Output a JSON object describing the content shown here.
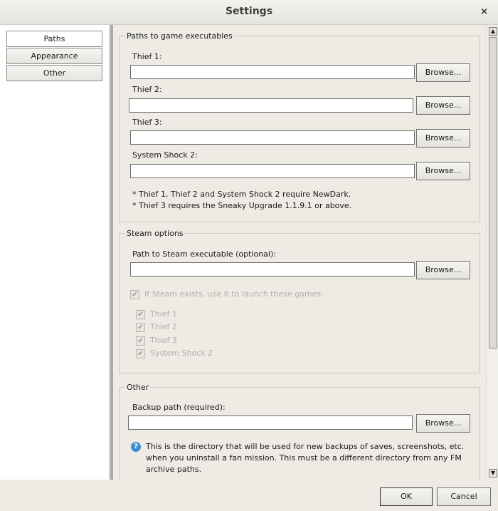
{
  "window": {
    "title": "Settings",
    "close_glyph": "×"
  },
  "nav": {
    "items": [
      "Paths",
      "Appearance",
      "Other"
    ],
    "selected": "Paths"
  },
  "paths_group": {
    "legend": "Paths to game executables",
    "fields": [
      {
        "label": "Thief 1:",
        "value": ""
      },
      {
        "label": "Thief 2:",
        "value": ""
      },
      {
        "label": "Thief 3:",
        "value": ""
      },
      {
        "label": "System Shock 2:",
        "value": ""
      }
    ],
    "browse_label": "Browse...",
    "notes": [
      "* Thief 1, Thief 2 and System Shock 2 require NewDark.",
      "* Thief 3 requires the Sneaky Upgrade 1.1.9.1 or above."
    ]
  },
  "steam_group": {
    "legend": "Steam options",
    "path_label": "Path to Steam executable (optional):",
    "path_value": "",
    "browse_label": "Browse...",
    "use_steam_label": "If Steam exists, use it to launch these games:",
    "games": [
      "Thief 1",
      "Thief 2",
      "Thief 3",
      "System Shock 2"
    ],
    "check_glyph": "✔"
  },
  "other_group": {
    "legend": "Other",
    "backup_label": "Backup path (required):",
    "backup_value": "",
    "browse_label": "Browse...",
    "info_glyph": "?",
    "info_lines": [
      "This is the directory that will be used for new backups of saves, screenshots, etc.",
      "when you uninstall a fan mission. This must be a different directory from any FM",
      "archive paths."
    ]
  },
  "footer": {
    "ok_label": "OK",
    "cancel_label": "Cancel"
  },
  "scrollbar": {
    "up_glyph": "▲",
    "down_glyph": "▼"
  },
  "icons": {
    "close": "close-icon",
    "info": "info-icon",
    "check": "check-icon",
    "scroll_up": "arrow-up-icon",
    "scroll_down": "arrow-down-icon"
  }
}
